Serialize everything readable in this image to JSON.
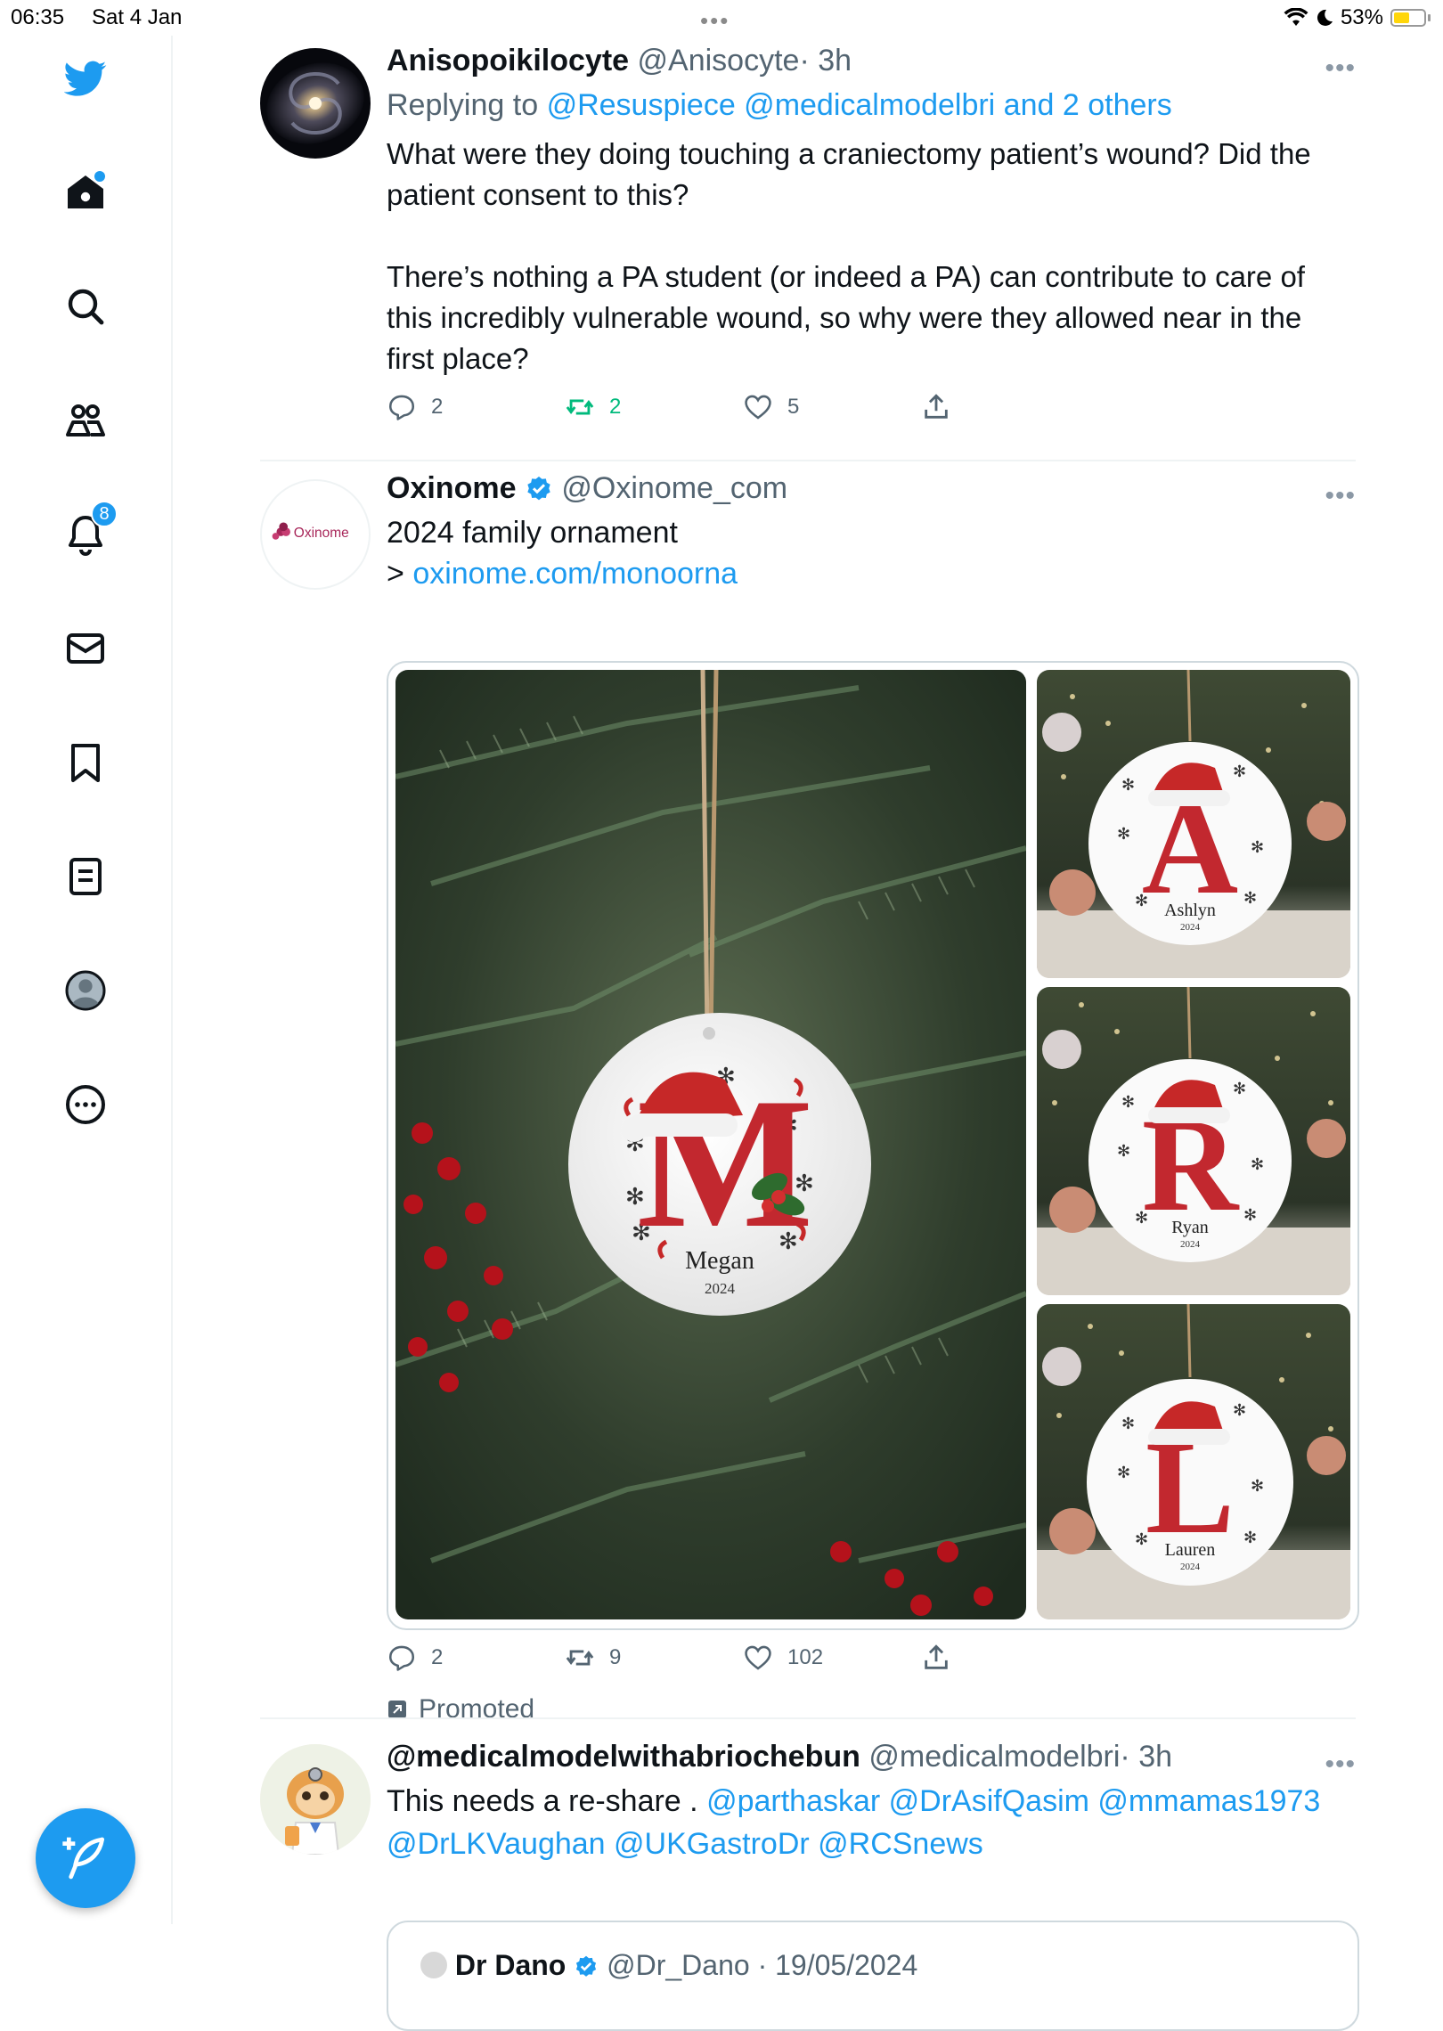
{
  "status_bar": {
    "time": "06:35",
    "date": "Sat 4 Jan",
    "battery": "53%",
    "battery_level": 0.53
  },
  "sidebar": {
    "items": [
      {
        "icon": "twitter-bird-icon"
      },
      {
        "icon": "home-icon",
        "has_dot": true
      },
      {
        "icon": "search-icon"
      },
      {
        "icon": "communities-icon"
      },
      {
        "icon": "notifications-icon",
        "badge": "8"
      },
      {
        "icon": "messages-icon"
      },
      {
        "icon": "bookmarks-icon"
      },
      {
        "icon": "lists-icon"
      },
      {
        "icon": "profile-icon"
      },
      {
        "icon": "more-icon"
      }
    ],
    "compose_icon": "compose-feather-icon",
    "accent": "#1d9bf0"
  },
  "tweets": [
    {
      "name": "Anisopoikilocyte",
      "handle": "@Anisocyte",
      "time": "· 3h",
      "reply_prefix": "Replying to",
      "reply_to": "@Resuspiece @medicalmodelbri and 2 others",
      "text": "What were they doing touching a craniectomy patient’s wound? Did the patient consent to this?\n\nThere’s nothing a PA student (or indeed a PA) can contribute to care of this incredibly vulnerable wound, so why were they allowed near in the first place?",
      "replies": "2",
      "retweets": "2",
      "likes": "5",
      "retweet_color": "#00ba7c"
    },
    {
      "name": "Oxinome",
      "verified": true,
      "handle": "@Oxinome_com",
      "avatar_text": "Oxinome",
      "text": "2024 family ornament",
      "link_prefix": "> ",
      "link": "oxinome.com/monoorna",
      "media": [
        {
          "letter": "M",
          "name": "Megan",
          "year": "2024"
        },
        {
          "letter": "A",
          "name": "Ashlyn",
          "year": "2024"
        },
        {
          "letter": "R",
          "name": "Ryan",
          "year": "2024"
        },
        {
          "letter": "L",
          "name": "Lauren",
          "year": "2024"
        }
      ],
      "replies": "2",
      "retweets": "9",
      "likes": "102",
      "promoted": "Promoted"
    },
    {
      "name": "@medicalmodelwithabriochebun",
      "handle": "@medicalmodelbri",
      "time": "· 3h",
      "text_prefix": "This needs a re-share . ",
      "mentions_1": "@parthaskar @DrAsifQasim @mmamas1973",
      "mentions_2": "@DrLKVaughan @UKGastroDr @RCSnews",
      "quoted": {
        "name": "Dr Dano",
        "handle": "@Dr_Dano",
        "date": "· 19/05/2024"
      }
    }
  ]
}
